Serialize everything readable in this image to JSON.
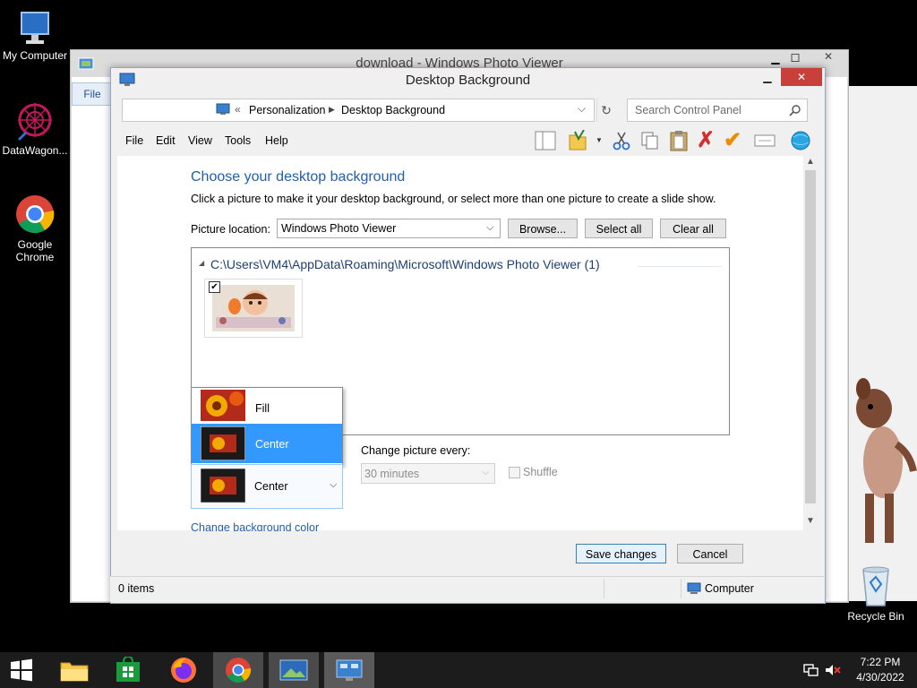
{
  "desktop": {
    "icons": [
      {
        "label": "My Computer"
      },
      {
        "label": "DataWagon..."
      },
      {
        "label": "Google Chrome"
      },
      {
        "label": "Recycle Bin"
      }
    ]
  },
  "photo_viewer": {
    "title": "download - Windows Photo Viewer",
    "file_menu": "File"
  },
  "dialog": {
    "title": "Desktop Background",
    "breadcrumb": [
      "Personalization",
      "Desktop Background"
    ],
    "breadcrumb_prefix": "«",
    "search_placeholder": "Search Control Panel",
    "menu": [
      "File",
      "Edit",
      "View",
      "Tools",
      "Help"
    ],
    "heading": "Choose your desktop background",
    "description": "Click a picture to make it your desktop background, or select more than one picture to create a slide show.",
    "picture_location_label": "Picture location:",
    "picture_location_value": "Windows Photo Viewer",
    "browse_label": "Browse...",
    "select_all_label": "Select all",
    "clear_all_label": "Clear all",
    "group_path": "C:\\Users\\VM4\\AppData\\Roaming\\Microsoft\\Windows Photo Viewer (1)",
    "thumbnail_checked": true,
    "position_options": [
      "Fill",
      "Center"
    ],
    "position_selected": "Center",
    "change_every_label": "Change picture every:",
    "change_every_value": "30 minutes",
    "shuffle_label": "Shuffle",
    "change_bg_color_link": "Change background color",
    "save_label": "Save changes",
    "cancel_label": "Cancel"
  },
  "statusbar": {
    "items": "0 items",
    "zone": "Computer"
  },
  "taskbar": {
    "time": "7:22 PM",
    "date": "4/30/2022"
  },
  "colors": {
    "accent": "#3399ff",
    "link": "#1f5fad",
    "close": "#c7403a"
  }
}
